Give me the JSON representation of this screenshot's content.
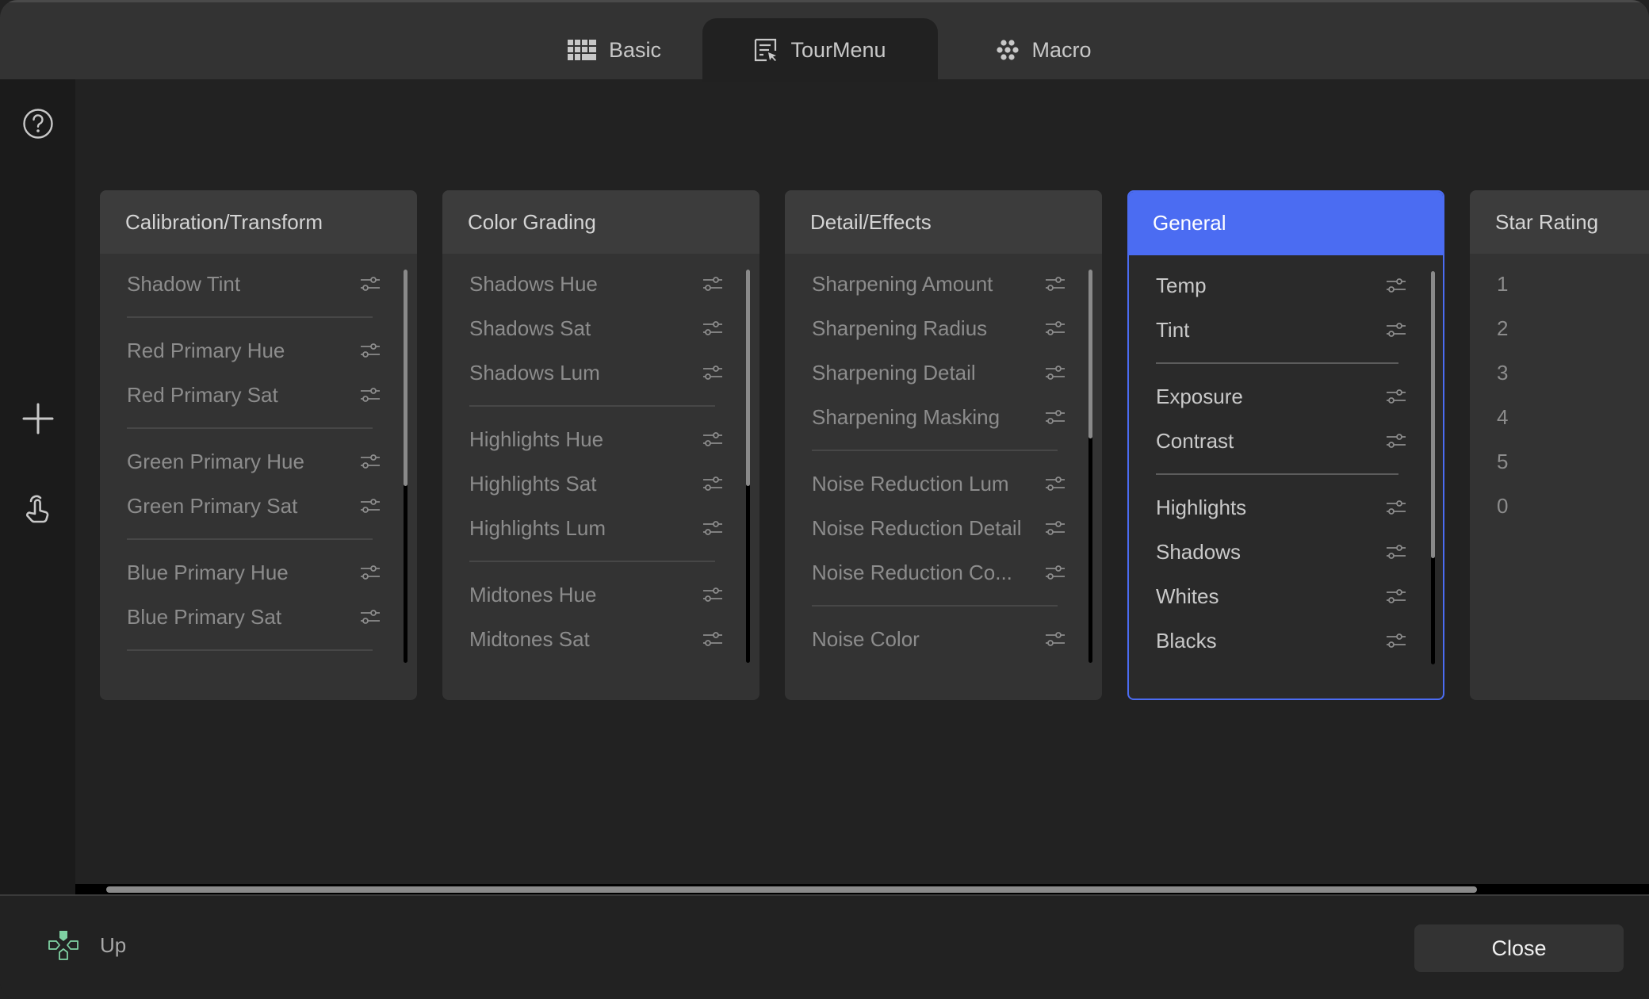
{
  "tabs": [
    {
      "label": "Basic",
      "icon": "keyboard-grid-icon",
      "active": false
    },
    {
      "label": "TourMenu",
      "icon": "menu-cursor-icon",
      "active": true
    },
    {
      "label": "Macro",
      "icon": "dots-cluster-icon",
      "active": false
    }
  ],
  "sidebar": {
    "help_icon": "question-circle-icon",
    "add_icon": "plus-icon",
    "touch_icon": "hand-pointer-icon"
  },
  "cards": [
    {
      "title": "Calibration/Transform",
      "selected": false,
      "groups": [
        [
          "Shadow Tint"
        ],
        [
          "Red Primary Hue",
          "Red Primary Sat"
        ],
        [
          "Green Primary Hue",
          "Green Primary Sat"
        ],
        [
          "Blue Primary Hue",
          "Blue Primary Sat"
        ]
      ],
      "trailing_separator": true,
      "scroll_fraction": 0.55
    },
    {
      "title": "Color Grading",
      "selected": false,
      "groups": [
        [
          "Shadows Hue",
          "Shadows Sat",
          "Shadows Lum"
        ],
        [
          "Highlights Hue",
          "Highlights Sat",
          "Highlights Lum"
        ],
        [
          "Midtones Hue",
          "Midtones Sat"
        ]
      ],
      "trailing_separator": false,
      "scroll_fraction": 0.55
    },
    {
      "title": "Detail/Effects",
      "selected": false,
      "groups": [
        [
          "Sharpening Amount",
          "Sharpening Radius",
          "Sharpening Detail",
          "Sharpening Masking"
        ],
        [
          "Noise Reduction Lum",
          "Noise Reduction Detail",
          "Noise Reduction Co..."
        ],
        [
          "Noise Color"
        ]
      ],
      "trailing_separator": false,
      "scroll_fraction": 0.43
    },
    {
      "title": "General",
      "selected": true,
      "groups": [
        [
          "Temp",
          "Tint"
        ],
        [
          "Exposure",
          "Contrast"
        ],
        [
          "Highlights",
          "Shadows",
          "Whites",
          "Blacks"
        ]
      ],
      "trailing_separator": false,
      "scroll_fraction": 0.73
    },
    {
      "title": "Star Rating",
      "selected": false,
      "items": [
        "1",
        "2",
        "3",
        "4",
        "5",
        "0"
      ]
    }
  ],
  "footer": {
    "hint_icon": "dpad-up-icon",
    "hint_label": "Up",
    "close_label": "Close"
  },
  "colors": {
    "accent": "#4b6cf2",
    "dpad": "#7fd1a3"
  }
}
